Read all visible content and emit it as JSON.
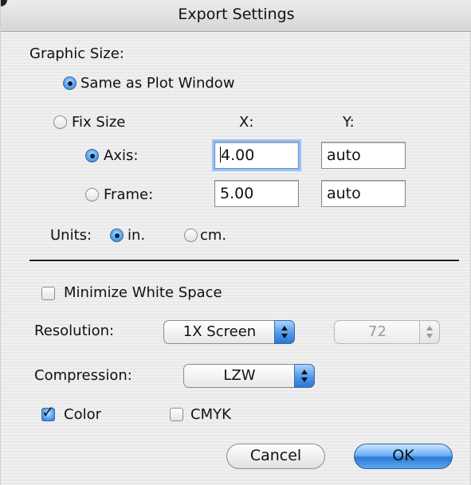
{
  "window": {
    "title": "Export Settings"
  },
  "graphic_size": {
    "label": "Graphic Size:",
    "same_as_plot": {
      "label": "Same as Plot Window",
      "selected": true
    },
    "fix_size": {
      "label": "Fix Size",
      "selected": false
    },
    "col_x": "X:",
    "col_y": "Y:",
    "axis": {
      "label": "Axis:",
      "selected": true,
      "x": "4.00",
      "y": "auto"
    },
    "frame": {
      "label": "Frame:",
      "selected": false,
      "x": "5.00",
      "y": "auto"
    }
  },
  "units": {
    "label": "Units:",
    "in": {
      "label": "in.",
      "selected": true
    },
    "cm": {
      "label": "cm.",
      "selected": false
    }
  },
  "minimize_white_space": {
    "label": "Minimize White Space",
    "checked": false
  },
  "resolution": {
    "label": "Resolution:",
    "value": "1X Screen",
    "dpi": "72"
  },
  "compression": {
    "label": "Compression:",
    "value": "LZW"
  },
  "color": {
    "label": "Color",
    "checked": true
  },
  "cmyk": {
    "label": "CMYK",
    "checked": false
  },
  "buttons": {
    "cancel": "Cancel",
    "ok": "OK"
  },
  "colors": {
    "accent": "#4f9ae9",
    "ok_button": "#2d7bd6"
  }
}
